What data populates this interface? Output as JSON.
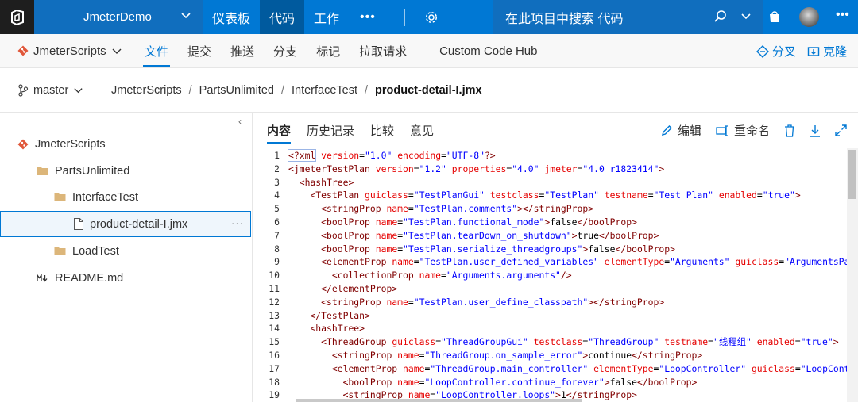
{
  "topbar": {
    "project": "JmeterDemo",
    "nav": [
      "仪表板",
      "代码",
      "工作"
    ],
    "active_nav": "代码",
    "more": "•••",
    "search_placeholder": "在此项目中搜索 代码",
    "more_right": "•••"
  },
  "subbar": {
    "repo": "JmeterScripts",
    "tabs": [
      "文件",
      "提交",
      "推送",
      "分支",
      "标记",
      "拉取请求"
    ],
    "active_tab": "文件",
    "custom_hub": "Custom Code Hub",
    "fork": "分叉",
    "clone": "克隆"
  },
  "breadcrumb": {
    "branch": "master",
    "path": [
      "JmeterScripts",
      "PartsUnlimited",
      "InterfaceTest"
    ],
    "current": "product-detail-I.jmx",
    "sep": "/"
  },
  "tree": {
    "root": "JmeterScripts",
    "items": [
      {
        "label": "PartsUnlimited",
        "type": "folder"
      },
      {
        "label": "InterfaceTest",
        "type": "folder"
      },
      {
        "label": "product-detail-I.jmx",
        "type": "file",
        "selected": true
      },
      {
        "label": "LoadTest",
        "type": "folder"
      },
      {
        "label": "README.md",
        "type": "markdown"
      }
    ],
    "item_more": "···",
    "collapse": "‹"
  },
  "content_tabs": [
    "内容",
    "历史记录",
    "比较",
    "意见"
  ],
  "active_content_tab": "内容",
  "actions": {
    "edit": "编辑",
    "rename": "重命名"
  },
  "code_lines": [
    {
      "n": "1"
    },
    {
      "n": "2"
    },
    {
      "n": "3"
    },
    {
      "n": "4"
    },
    {
      "n": "5"
    },
    {
      "n": "6"
    },
    {
      "n": "7"
    },
    {
      "n": "8"
    },
    {
      "n": "9"
    },
    {
      "n": "10"
    },
    {
      "n": "11"
    },
    {
      "n": "12"
    },
    {
      "n": "13"
    },
    {
      "n": "14"
    },
    {
      "n": "15"
    },
    {
      "n": "16"
    },
    {
      "n": "17"
    },
    {
      "n": "18"
    },
    {
      "n": "19"
    }
  ],
  "code": [
    [
      [
        "pi",
        "<?xml"
      ],
      [
        "t",
        " "
      ],
      [
        "attr",
        "version"
      ],
      [
        "t",
        "="
      ],
      [
        "str",
        "\"1.0\""
      ],
      [
        "t",
        " "
      ],
      [
        "attr",
        "encoding"
      ],
      [
        "t",
        "="
      ],
      [
        "str",
        "\"UTF-8\""
      ],
      [
        "pi",
        "?>"
      ]
    ],
    [
      [
        "tag",
        "<jmeterTestPlan"
      ],
      [
        "t",
        " "
      ],
      [
        "attr",
        "version"
      ],
      [
        "t",
        "="
      ],
      [
        "str",
        "\"1.2\""
      ],
      [
        "t",
        " "
      ],
      [
        "attr",
        "properties"
      ],
      [
        "t",
        "="
      ],
      [
        "str",
        "\"4.0\""
      ],
      [
        "t",
        " "
      ],
      [
        "attr",
        "jmeter"
      ],
      [
        "t",
        "="
      ],
      [
        "str",
        "\"4.0 r1823414\""
      ],
      [
        "tag",
        ">"
      ]
    ],
    [
      [
        "t",
        "  "
      ],
      [
        "tag",
        "<hashTree>"
      ]
    ],
    [
      [
        "t",
        "    "
      ],
      [
        "tag",
        "<TestPlan"
      ],
      [
        "t",
        " "
      ],
      [
        "attr",
        "guiclass"
      ],
      [
        "t",
        "="
      ],
      [
        "str",
        "\"TestPlanGui\""
      ],
      [
        "t",
        " "
      ],
      [
        "attr",
        "testclass"
      ],
      [
        "t",
        "="
      ],
      [
        "str",
        "\"TestPlan\""
      ],
      [
        "t",
        " "
      ],
      [
        "attr",
        "testname"
      ],
      [
        "t",
        "="
      ],
      [
        "str",
        "\"Test Plan\""
      ],
      [
        "t",
        " "
      ],
      [
        "attr",
        "enabled"
      ],
      [
        "t",
        "="
      ],
      [
        "str",
        "\"true\""
      ],
      [
        "tag",
        ">"
      ]
    ],
    [
      [
        "t",
        "      "
      ],
      [
        "tag",
        "<stringProp"
      ],
      [
        "t",
        " "
      ],
      [
        "attr",
        "name"
      ],
      [
        "t",
        "="
      ],
      [
        "str",
        "\"TestPlan.comments\""
      ],
      [
        "tag",
        "></stringProp>"
      ]
    ],
    [
      [
        "t",
        "      "
      ],
      [
        "tag",
        "<boolProp"
      ],
      [
        "t",
        " "
      ],
      [
        "attr",
        "name"
      ],
      [
        "t",
        "="
      ],
      [
        "str",
        "\"TestPlan.functional_mode\""
      ],
      [
        "tag",
        ">"
      ],
      [
        "t",
        "false"
      ],
      [
        "tag",
        "</boolProp>"
      ]
    ],
    [
      [
        "t",
        "      "
      ],
      [
        "tag",
        "<boolProp"
      ],
      [
        "t",
        " "
      ],
      [
        "attr",
        "name"
      ],
      [
        "t",
        "="
      ],
      [
        "str",
        "\"TestPlan.tearDown_on_shutdown\""
      ],
      [
        "tag",
        ">"
      ],
      [
        "t",
        "true"
      ],
      [
        "tag",
        "</boolProp>"
      ]
    ],
    [
      [
        "t",
        "      "
      ],
      [
        "tag",
        "<boolProp"
      ],
      [
        "t",
        " "
      ],
      [
        "attr",
        "name"
      ],
      [
        "t",
        "="
      ],
      [
        "str",
        "\"TestPlan.serialize_threadgroups\""
      ],
      [
        "tag",
        ">"
      ],
      [
        "t",
        "false"
      ],
      [
        "tag",
        "</boolProp>"
      ]
    ],
    [
      [
        "t",
        "      "
      ],
      [
        "tag",
        "<elementProp"
      ],
      [
        "t",
        " "
      ],
      [
        "attr",
        "name"
      ],
      [
        "t",
        "="
      ],
      [
        "str",
        "\"TestPlan.user_defined_variables\""
      ],
      [
        "t",
        " "
      ],
      [
        "attr",
        "elementType"
      ],
      [
        "t",
        "="
      ],
      [
        "str",
        "\"Arguments\""
      ],
      [
        "t",
        " "
      ],
      [
        "attr",
        "guiclass"
      ],
      [
        "t",
        "="
      ],
      [
        "str",
        "\"ArgumentsPa"
      ]
    ],
    [
      [
        "t",
        "        "
      ],
      [
        "tag",
        "<collectionProp"
      ],
      [
        "t",
        " "
      ],
      [
        "attr",
        "name"
      ],
      [
        "t",
        "="
      ],
      [
        "str",
        "\"Arguments.arguments\""
      ],
      [
        "tag",
        "/>"
      ]
    ],
    [
      [
        "t",
        "      "
      ],
      [
        "tag",
        "</elementProp>"
      ]
    ],
    [
      [
        "t",
        "      "
      ],
      [
        "tag",
        "<stringProp"
      ],
      [
        "t",
        " "
      ],
      [
        "attr",
        "name"
      ],
      [
        "t",
        "="
      ],
      [
        "str",
        "\"TestPlan.user_define_classpath\""
      ],
      [
        "tag",
        "></stringProp>"
      ]
    ],
    [
      [
        "t",
        "    "
      ],
      [
        "tag",
        "</TestPlan>"
      ]
    ],
    [
      [
        "t",
        "    "
      ],
      [
        "tag",
        "<hashTree>"
      ]
    ],
    [
      [
        "t",
        "      "
      ],
      [
        "tag",
        "<ThreadGroup"
      ],
      [
        "t",
        " "
      ],
      [
        "attr",
        "guiclass"
      ],
      [
        "t",
        "="
      ],
      [
        "str",
        "\"ThreadGroupGui\""
      ],
      [
        "t",
        " "
      ],
      [
        "attr",
        "testclass"
      ],
      [
        "t",
        "="
      ],
      [
        "str",
        "\"ThreadGroup\""
      ],
      [
        "t",
        " "
      ],
      [
        "attr",
        "testname"
      ],
      [
        "t",
        "="
      ],
      [
        "str",
        "\"线程组\""
      ],
      [
        "t",
        " "
      ],
      [
        "attr",
        "enabled"
      ],
      [
        "t",
        "="
      ],
      [
        "str",
        "\"true\""
      ],
      [
        "tag",
        ">"
      ]
    ],
    [
      [
        "t",
        "        "
      ],
      [
        "tag",
        "<stringProp"
      ],
      [
        "t",
        " "
      ],
      [
        "attr",
        "name"
      ],
      [
        "t",
        "="
      ],
      [
        "str",
        "\"ThreadGroup.on_sample_error\""
      ],
      [
        "tag",
        ">"
      ],
      [
        "t",
        "continue"
      ],
      [
        "tag",
        "</stringProp>"
      ]
    ],
    [
      [
        "t",
        "        "
      ],
      [
        "tag",
        "<elementProp"
      ],
      [
        "t",
        " "
      ],
      [
        "attr",
        "name"
      ],
      [
        "t",
        "="
      ],
      [
        "str",
        "\"ThreadGroup.main_controller\""
      ],
      [
        "t",
        " "
      ],
      [
        "attr",
        "elementType"
      ],
      [
        "t",
        "="
      ],
      [
        "str",
        "\"LoopController\""
      ],
      [
        "t",
        " "
      ],
      [
        "attr",
        "guiclass"
      ],
      [
        "t",
        "="
      ],
      [
        "str",
        "\"LoopCont"
      ]
    ],
    [
      [
        "t",
        "          "
      ],
      [
        "tag",
        "<boolProp"
      ],
      [
        "t",
        " "
      ],
      [
        "attr",
        "name"
      ],
      [
        "t",
        "="
      ],
      [
        "str",
        "\"LoopController.continue_forever\""
      ],
      [
        "tag",
        ">"
      ],
      [
        "t",
        "false"
      ],
      [
        "tag",
        "</boolProp>"
      ]
    ],
    [
      [
        "t",
        "          "
      ],
      [
        "tag",
        "<stringProp"
      ],
      [
        "t",
        " "
      ],
      [
        "attr",
        "name"
      ],
      [
        "t",
        "="
      ],
      [
        "str",
        "\"LoopController.loops\""
      ],
      [
        "tag",
        ">"
      ],
      [
        "t",
        "1"
      ],
      [
        "tag",
        "</stringProp>"
      ]
    ]
  ]
}
